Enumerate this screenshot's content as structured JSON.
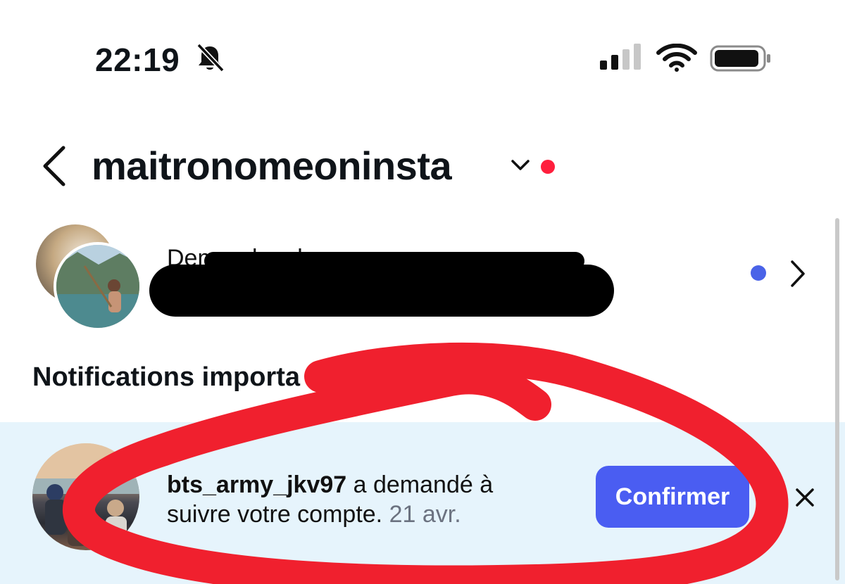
{
  "status_bar": {
    "time": "22:19",
    "icons": [
      "bell-slash-icon",
      "signal-icon",
      "wifi-icon",
      "battery-icon"
    ]
  },
  "header": {
    "username": "maitronomeoninsta",
    "icons": [
      "back-chevron-icon",
      "chevron-down-icon"
    ],
    "unread_dot_color": "#ff1f3d"
  },
  "follow_requests": {
    "title": "Demandes de",
    "indicator_color": "#4a63e8"
  },
  "section": {
    "title": "Notifications importa"
  },
  "notification": {
    "username": "bts_army_jkv97",
    "message_part1": " a demandé à",
    "message_part2": "suivre votre compte.",
    "date": " 21 avr.",
    "confirm_label": "Confirmer",
    "highlight_color": "#e6f4fc",
    "button_color": "#4a5df2"
  },
  "annotation": {
    "circle_color": "#f0202e",
    "redaction_color": "#000000"
  }
}
